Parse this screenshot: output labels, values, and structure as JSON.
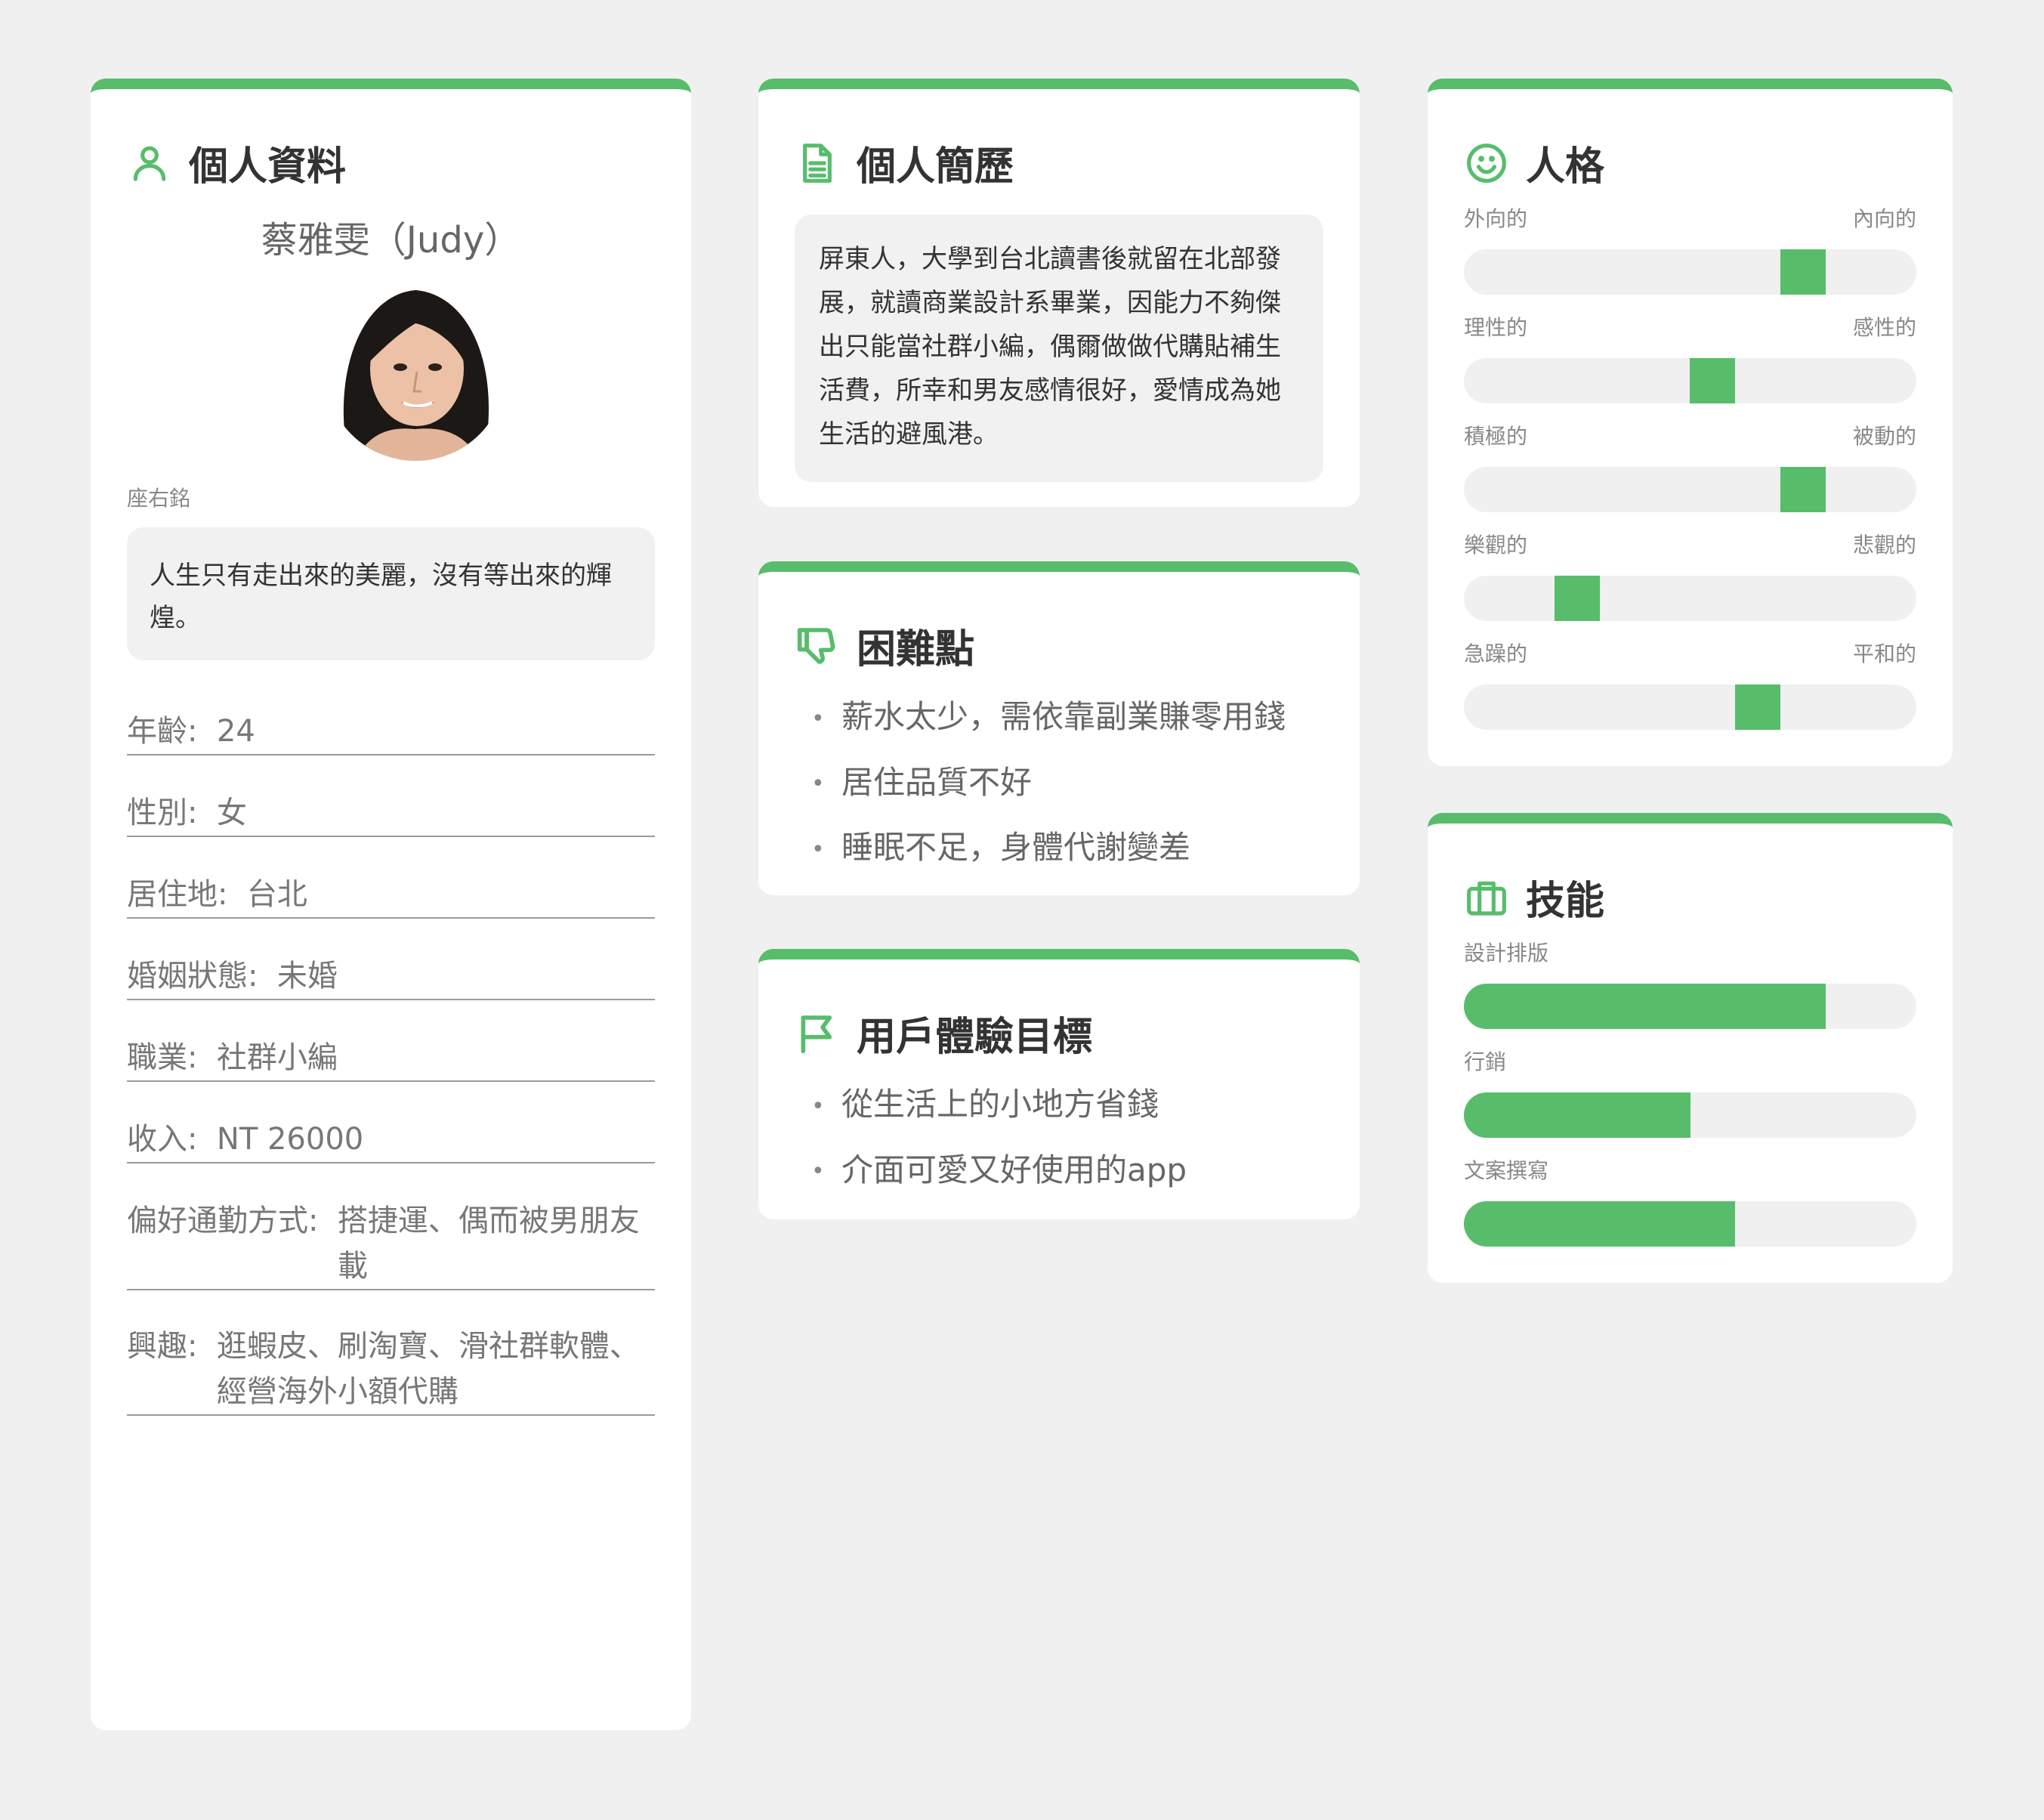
{
  "accent_color": "#57bd6b",
  "profile": {
    "title": "個人資料",
    "name": "蔡雅雯（Judy）",
    "motto_label": "座右銘",
    "motto": "人生只有走出來的美麗，沒有等出來的輝煌。",
    "fields": [
      {
        "key": "年齡",
        "value": "24"
      },
      {
        "key": "性別",
        "value": "女"
      },
      {
        "key": "居住地",
        "value": "台北"
      },
      {
        "key": "婚姻狀態",
        "value": "未婚"
      },
      {
        "key": "職業",
        "value": "社群小編"
      },
      {
        "key": "收入",
        "value": "NT 26000"
      },
      {
        "key": "偏好通勤方式",
        "value": "搭捷運、偶而被男朋友載"
      },
      {
        "key": "興趣",
        "value": "逛蝦皮、刷淘寶、滑社群軟體、經營海外小額代購"
      }
    ]
  },
  "resume": {
    "title": "個人簡歷",
    "text": "屏東人，大學到台北讀書後就留在北部發展，就讀商業設計系畢業，因能力不夠傑出只能當社群小編，偶爾做做代購貼補生活費，所幸和男友感情很好，愛情成為她生活的避風港。"
  },
  "pain_points": {
    "title": "困難點",
    "items": [
      "薪水太少，需依靠副業賺零用錢",
      "居住品質不好",
      "睡眠不足，身體代謝變差"
    ]
  },
  "ux_goals": {
    "title": "用戶體驗目標",
    "items": [
      "從生活上的小地方省錢",
      "介面可愛又好使用的app"
    ]
  },
  "personality": {
    "title": "人格",
    "traits": [
      {
        "left": "外向的",
        "right": "內向的",
        "value": 0.75
      },
      {
        "left": "理性的",
        "right": "感性的",
        "value": 0.55
      },
      {
        "left": "積極的",
        "right": "被動的",
        "value": 0.75
      },
      {
        "left": "樂觀的",
        "right": "悲觀的",
        "value": 0.25
      },
      {
        "left": "急躁的",
        "right": "平和的",
        "value": 0.65
      }
    ]
  },
  "skills": {
    "title": "技能",
    "items": [
      {
        "name": "設計排版",
        "value": 0.8
      },
      {
        "name": "行銷",
        "value": 0.5
      },
      {
        "name": "文案撰寫",
        "value": 0.6
      }
    ]
  }
}
